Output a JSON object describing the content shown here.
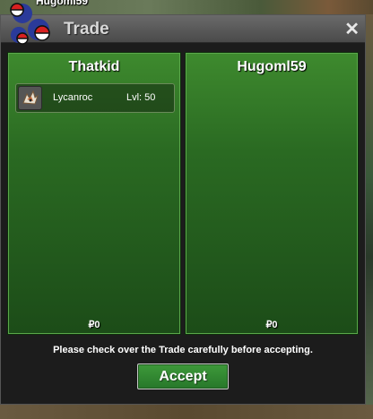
{
  "background": {
    "top_player_name": "Hugoml59"
  },
  "window": {
    "title": "Trade",
    "close_glyph": "✕",
    "logo_icon": "pokeball-logo-icon"
  },
  "left_panel": {
    "name": "Thatkid",
    "items": [
      {
        "name": "Lycanroc",
        "level": "Lvl: 50",
        "icon": "lycanroc-icon"
      }
    ],
    "money": "₽0"
  },
  "right_panel": {
    "name": "Hugoml59",
    "money": "₽0"
  },
  "notice": "Please check over the Trade carefully before accepting.",
  "accept_label": "Accept",
  "colors": {
    "panel_green": "#2a6a22",
    "accept_green": "#3e9a3a",
    "titlebar_gray": "#5a5a5a"
  }
}
